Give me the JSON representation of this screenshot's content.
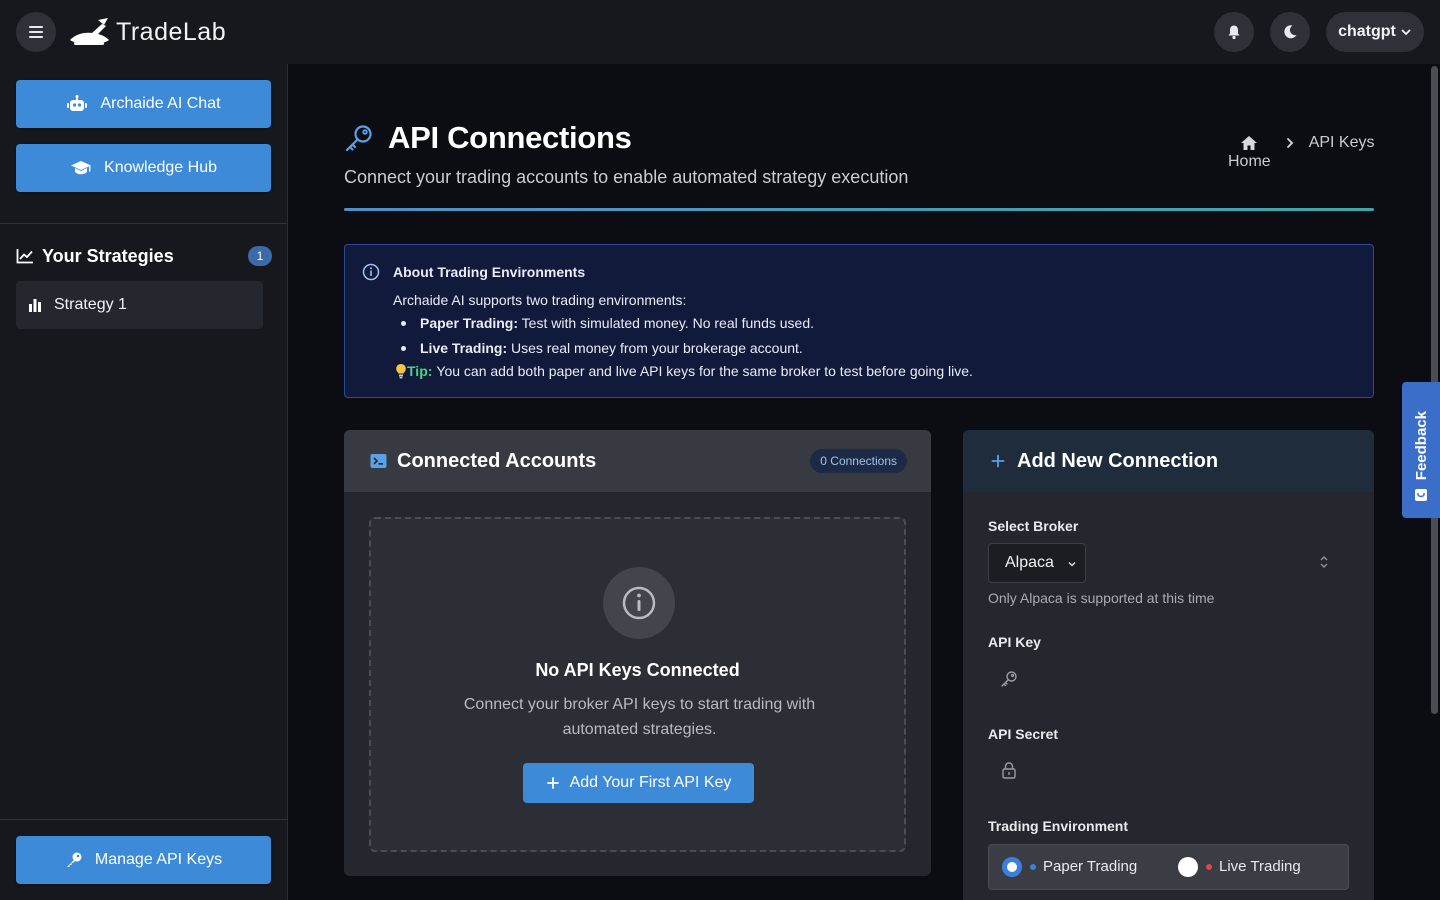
{
  "app": {
    "name": "TradeLab"
  },
  "topbar": {
    "user_label": "chatgpt"
  },
  "sidebar": {
    "chat_button": "Archaide AI Chat",
    "knowledge_button": "Knowledge Hub",
    "strategies_title": "Your Strategies",
    "strategies_count": "1",
    "strategies": [
      {
        "label": "Strategy 1"
      }
    ],
    "manage_button": "Manage API Keys"
  },
  "page": {
    "title": "API Connections",
    "subtitle": "Connect your trading accounts to enable automated strategy execution",
    "breadcrumb": {
      "home": "Home",
      "current": "API Keys"
    }
  },
  "info": {
    "title": "About Trading Environments",
    "intro": "Archaide AI supports two trading environments:",
    "items": [
      {
        "label": "Paper Trading:",
        "text": " Test with simulated money. No real funds used."
      },
      {
        "label": "Live Trading:",
        "text": " Uses real money from your brokerage account."
      }
    ],
    "tip_label": "Tip:",
    "tip_text": "You can add both paper and live API keys for the same broker to test before going live."
  },
  "connected": {
    "title": "Connected Accounts",
    "badge": "0 Connections",
    "empty_title": "No API Keys Connected",
    "empty_desc": "Connect your broker API keys to start trading with automated strategies.",
    "add_first_button": "Add Your First API Key"
  },
  "add_connection": {
    "title": "Add New Connection",
    "broker_label": "Select Broker",
    "broker_value": "Alpaca",
    "broker_help": "Only Alpaca is supported at this time",
    "api_key_label": "API Key",
    "api_key_value": "",
    "api_secret_label": "API Secret",
    "api_secret_value": "",
    "env_label": "Trading Environment",
    "env_options": [
      {
        "label": "Paper Trading",
        "selected": true,
        "dot_color": "#3d7fe0"
      },
      {
        "label": "Live Trading",
        "selected": false,
        "dot_color": "#e04848"
      }
    ]
  },
  "feedback": {
    "label": "Feedback"
  },
  "colors": {
    "primary": "#3d8ad8",
    "tip": "#4fd081",
    "info_border": "#2b4a9a"
  }
}
